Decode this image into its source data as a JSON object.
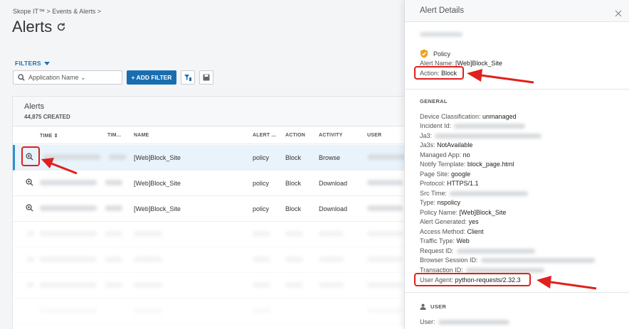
{
  "breadcrumb": "Skope IT™ > Events & Alerts >",
  "page_title": "Alerts",
  "filters_label": "FILTERS",
  "search": {
    "placeholder": "Application Name ⌄"
  },
  "add_filter_label": "+ ADD FILTER",
  "table": {
    "title": "Alerts",
    "count": "44,875 CREATED",
    "columns": {
      "time": "TIME ⇕",
      "tim2": "TIM...",
      "name": "NAME",
      "alert": "ALERT ...",
      "action": "ACTION",
      "activity": "ACTIVITY",
      "user": "USER"
    },
    "rows": [
      {
        "name": "[Web]Block_Site",
        "alert": "policy",
        "action": "Block",
        "activity": "Browse"
      },
      {
        "name": "[Web]Block_Site",
        "alert": "policy",
        "action": "Block",
        "activity": "Download"
      },
      {
        "name": "[Web]Block_Site",
        "alert": "policy",
        "action": "Block",
        "activity": "Download"
      }
    ]
  },
  "panel": {
    "title": "Alert Details",
    "policy_label": "Policy",
    "alert_name_key": "Alert Name:",
    "alert_name_val": "[Web]Block_Site",
    "action_key": "Action:",
    "action_val": "Block",
    "general_title": "GENERAL",
    "fields": [
      {
        "k": "Device Classification:",
        "v": "unmanaged"
      },
      {
        "k": "Incident Id:",
        "v": ""
      },
      {
        "k": "Ja3:",
        "v": ""
      },
      {
        "k": "Ja3s:",
        "v": "NotAvailable"
      },
      {
        "k": "Managed App:",
        "v": "no"
      },
      {
        "k": "Notify Template:",
        "v": "block_page.html"
      },
      {
        "k": "Page Site:",
        "v": "google"
      },
      {
        "k": "Protocol:",
        "v": "HTTPS/1.1"
      },
      {
        "k": "Src Time:",
        "v": ""
      },
      {
        "k": "Type:",
        "v": "nspolicy"
      },
      {
        "k": "Policy Name:",
        "v": "[Web]Block_Site"
      },
      {
        "k": "Alert Generated:",
        "v": "yes"
      },
      {
        "k": "Access Method:",
        "v": "Client"
      },
      {
        "k": "Traffic Type:",
        "v": "Web"
      },
      {
        "k": "Request ID:",
        "v": ""
      },
      {
        "k": "Browser Session ID:",
        "v": ""
      },
      {
        "k": "Transaction ID:",
        "v": ""
      }
    ],
    "user_agent_key": "User Agent:",
    "user_agent_val": "python-requests/2.32.3",
    "user_title": "USER",
    "user_key": "User:"
  }
}
